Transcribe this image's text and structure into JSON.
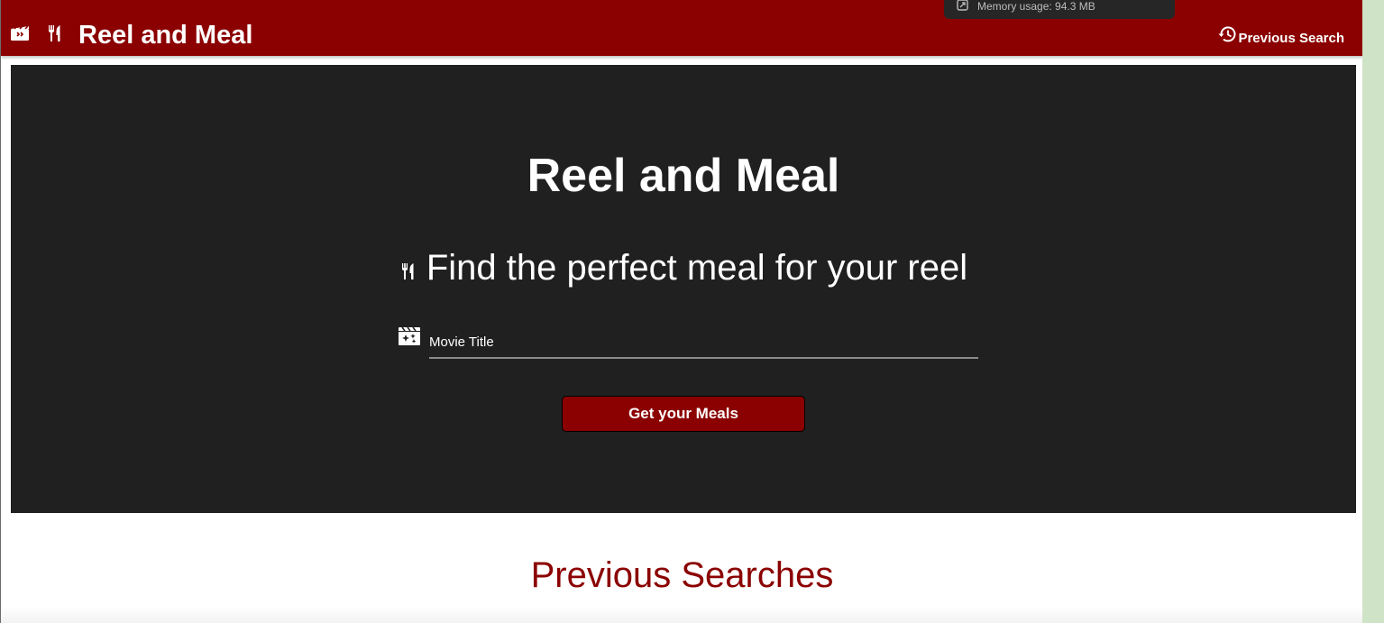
{
  "navbar": {
    "brand_title": "Reel and Meal",
    "previous_search_label": "Previous Search",
    "background": "#8b0000"
  },
  "tooltip": {
    "text": "Memory usage: 94.3 MB"
  },
  "hero": {
    "title": "Reel and Meal",
    "subtitle": "Find the perfect meal for your reel",
    "input_placeholder": "Movie Title",
    "input_value": "",
    "button_label": "Get your Meals",
    "background": "#202020"
  },
  "previous": {
    "heading": "Previous Searches"
  },
  "icons": {
    "nav_movie": "clapperboard-icon",
    "nav_meal": "fork-knife-icon",
    "history": "history-icon",
    "subtitle_meal": "fork-knife-icon",
    "input_movie": "movie-filter-icon",
    "memory": "memory-icon"
  },
  "colors": {
    "accent": "#8b0000",
    "hero": "#202020"
  }
}
